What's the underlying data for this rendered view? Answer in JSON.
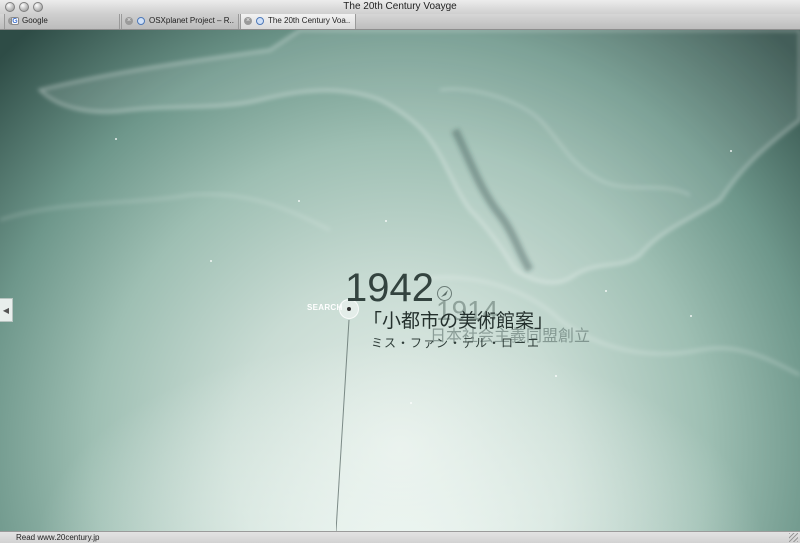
{
  "window": {
    "title": "The 20th Century Voayge",
    "controls": [
      "close-icon",
      "minimize-icon",
      "zoom-icon"
    ]
  },
  "tabs": [
    {
      "label": "Google",
      "favicon": "google-icon",
      "active": false
    },
    {
      "label": "OSXplanet Project – R...",
      "favicon": "globe-icon",
      "active": false
    },
    {
      "label": "The 20th Century Voa...",
      "favicon": "globe-icon",
      "active": true
    }
  ],
  "content": {
    "search_label": "SEARCH",
    "year": "1942",
    "title": "「小都市の美術館案」",
    "subtitle": "ミス・ファン・デル・ローエ",
    "ghost_year": "1914",
    "ghost_subtitle": "日本社会主義同盟創立",
    "left_nav_glyph": "◀",
    "icons": [
      "compass-icon",
      "search-knob-icon",
      "left-arrow-icon"
    ],
    "colors": {
      "globe_dark": "#2e4c46",
      "globe_mid": "#9ebfb3",
      "globe_light": "#e6efea",
      "text": "#33433f"
    }
  },
  "status": {
    "text": "Read www.20century.jp"
  }
}
